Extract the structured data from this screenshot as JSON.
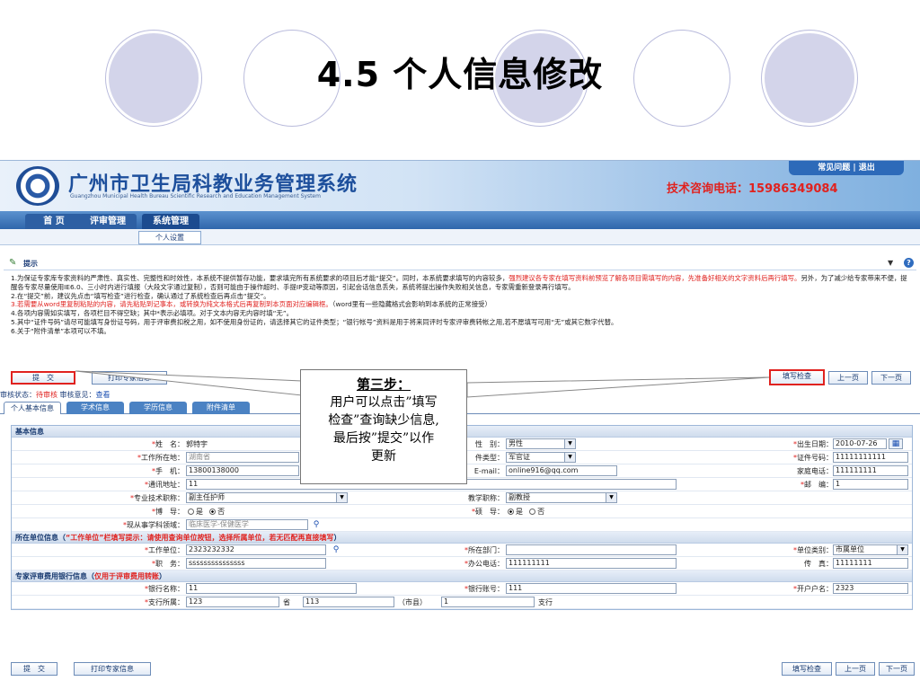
{
  "slide": {
    "title": "4.5 个人信息修改"
  },
  "header": {
    "system_name": "广州市卫生局科教业务管理系统",
    "system_name_en": "Guangzhou Municipal Health Bureau Scientific Research and Education Management System",
    "hotline_label": "技术咨询电话：",
    "hotline_number": "15986349084",
    "link_faq": "常见问题",
    "link_separator": "|",
    "link_logout": "退出"
  },
  "nav": {
    "tabs": [
      "首 页",
      "评审管理",
      "系统管理"
    ],
    "sub_item": "个人设置"
  },
  "tips": {
    "title": "提示",
    "line1_a": "1.为保证专家库专家资料的严肃性、真实性、完整性和时效性，本系统不提供暂存功能，要求填完所有系统要求的项目后才能“提交”。同时，本系统要求填写的内容较多，",
    "line1_red": "强烈建议各专家在填写资料前预览了解各项目需填写的内容，先准备好相关的文字资料后再行填写。",
    "line1_b": "另外，为了减少给专家带来不便，提醒各专家尽量使用IE6.0、三小时内进行填报（大段文字通过复制），否则可能由于操作超时、手提IP变动等原因，引起会话信息丢失，系统将提出操作失败相关信息，专家需重新登录再行填写。",
    "line2": "2.在“提交”前，建议先点击“填写检查”进行检查，确认通过了系统检查后再点击“提交”。",
    "line3_red": "3.若需要从word里复制粘贴的内容，请先粘贴到记事本，或转换为纯文本格式后再复制到本页面对应编辑框。",
    "line3_b": "（word里有一些隐藏格式会影响到本系统的正常接受）",
    "line4": "4.各项内容需如实填写，各项栏目不得空缺；其中*表示必填项。对于文本内容无内容时填“无”。",
    "line5": "5.其中“证件号码”请尽可能填写身份证号码，用于评审费扣税之用，如不使用身份证的，请选择其它的证件类型；“银行帐号”资料是用于将来同评时专家评审费转帐之用,若不愿填写可用“无”或其它数字代替。",
    "line6": "6.关于“附件清单”本项可以不填。"
  },
  "actions": {
    "submit": "提　交",
    "print": "打印专家信息",
    "check": "填写检查",
    "prev": "上一页",
    "next": "下一页"
  },
  "review": {
    "status_label": "审核状态：",
    "status_value": "待审核",
    "opinion_label": "审核意见：",
    "opinion_link": "查看"
  },
  "tabs": [
    "个人基本信息",
    "学术信息",
    "学历信息",
    "附件清单"
  ],
  "form": {
    "sec_basic": "基本信息",
    "name_label": "姓　名：",
    "name_value": "郭特宇",
    "gender_label": "性　别：",
    "gender_value": "男性",
    "birth_label": "出生日期：",
    "birth_value": "2010-07-26",
    "workplace_label": "工作所在地：",
    "workplace_value": "湖南省",
    "idtype_label": "件类型：",
    "idtype_value": "军官证",
    "idnum_label": "证件号码：",
    "idnum_value": "11111111111",
    "mobile_label": "手　机：",
    "mobile_value": "13800138000",
    "email_label": "E-mail：",
    "email_value": "online916@qq.com",
    "homephone_label": "家庭电话：",
    "homephone_value": "111111111",
    "address_label": "通讯地址：",
    "address_value": "11",
    "zip_label": "邮　编：",
    "zip_value": "1",
    "title_label": "专业技术职称：",
    "title_value": "副主任护师",
    "teach_label": "教学职称：",
    "teach_value": "副教授",
    "phd_label": "博　导：",
    "phd_no": "是",
    "phd_yes": "否",
    "master_label": "硕　导：",
    "master_yes": "是",
    "master_no": "否",
    "field_label": "现从事学科领域：",
    "field_value": "临床医学-保健医学",
    "sec_unit": "所在单位信息（",
    "sec_unit_red": "“工作单位”栏填写提示：请使用查询单位按钮，选择所属单位，若无匹配再直接填写",
    "sec_unit_end": "）",
    "unit_label": "工作单位：",
    "unit_value": "2323232332",
    "dept_label": "所在部门：",
    "dept_value": "",
    "unittype_label": "单位类别：",
    "unittype_value": "市属单位",
    "duty_label": "职　务：",
    "duty_value": "sssssssssssssss",
    "office_label": "办公电话：",
    "office_value": "111111111",
    "fax_label": "传　真：",
    "fax_value": "11111111",
    "sec_bank": "专家评审费用银行信息（",
    "sec_bank_red": "仅用于评审费用转账",
    "sec_bank_end": "）",
    "bank_label": "银行名称：",
    "bank_value": "11",
    "account_label": "银行账号：",
    "account_value": "111",
    "holder_label": "开户户名：",
    "holder_value": "2323",
    "branch_label": "支行所属：",
    "branch_value": "123",
    "province_suffix": "省",
    "city_value": "113",
    "city_suffix": "（市县）",
    "county_value": "1",
    "branch_suffix": "支行"
  },
  "callout": {
    "heading": "第三步：",
    "line1": "用户可以点击”填写",
    "line2": "检查”查询缺少信息,",
    "line3": "最后按”提交”以作",
    "line4": "更新"
  }
}
